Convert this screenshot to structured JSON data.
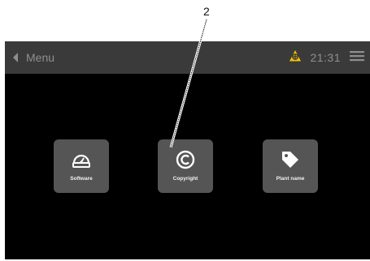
{
  "callout": {
    "number": "2"
  },
  "topbar": {
    "back_icon": "chevron-left-icon",
    "title": "Menu",
    "warning_icon": "warning-icon",
    "time": "21:31",
    "menu_icon": "hamburger-menu-icon"
  },
  "tiles": [
    {
      "label": "Software",
      "icon": "gauge-icon"
    },
    {
      "label": "Copyright",
      "icon": "copyright-icon"
    },
    {
      "label": "Plant name",
      "icon": "tag-icon"
    }
  ],
  "colors": {
    "topbar_bg": "#3a3a3a",
    "screen_bg": "#000000",
    "tile_bg": "#555555",
    "warning": "#f2c200",
    "topbar_text": "#8e8e8e"
  }
}
